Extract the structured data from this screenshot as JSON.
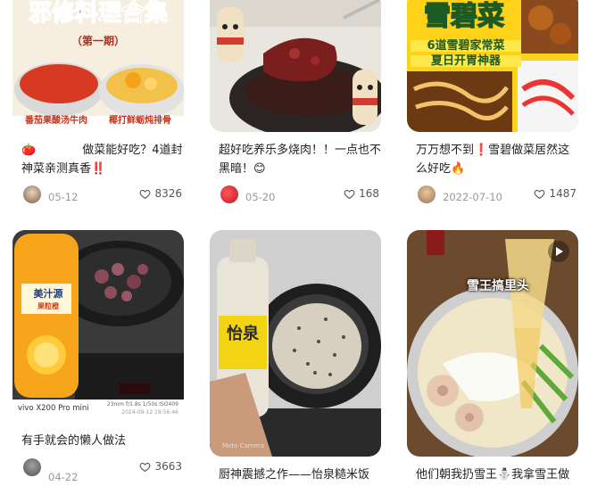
{
  "cards": [
    {
      "thumb": {
        "headline": "邪修料理合集",
        "subline": "（第一期）",
        "tag_left": "番茄果酸汤牛肉",
        "tag_right": "椰打鲜蛎炖排骨"
      },
      "title_prefix": "🍅",
      "title": "做菜能好吃？4道封神菜亲测真香‼️",
      "date": "05-12",
      "likes": "8326"
    },
    {
      "title": "超好吃养乐多烧肉！！一点也不黑暗！😊",
      "date": "05-20",
      "likes": "168"
    },
    {
      "thumb": {
        "headline": "雪碧菜",
        "subline": "6道雪碧家常菜",
        "subline2": "夏日开胃神器"
      },
      "title": "万万想不到❗雪碧做菜居然这么好吃🔥",
      "date": "2022-07-10",
      "likes": "1487"
    },
    {
      "thumb": {
        "brand": "美汁源",
        "flavor": "果粒橙",
        "camera": "vivo X200 Pro mini",
        "specs": "23mm  f/1.8s 1/50s  ISO409",
        "stamp": "2024-09-12 19:56:46"
      },
      "title": "有手就会的懒人做法",
      "date": "04-22",
      "likes": "3663"
    },
    {
      "thumb": {
        "brand": "怡泉",
        "watermark": "Moto Camera"
      },
      "title": "厨神震撼之作——怡泉糙米饭",
      "date": "",
      "likes": ""
    },
    {
      "thumb": {
        "caption": "雪王搞里头"
      },
      "title": "他们朝我扔雪王⛄我拿雪王做",
      "date": "",
      "likes": ""
    }
  ]
}
